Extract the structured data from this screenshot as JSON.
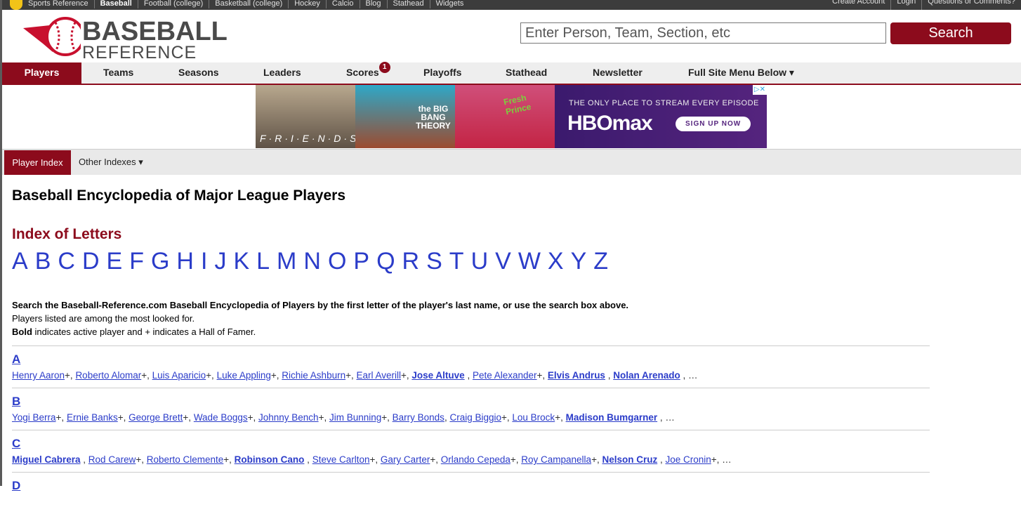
{
  "topbar": {
    "links": [
      "Sports Reference",
      "Baseball",
      "Football (college)",
      "Basketball (college)",
      "Hockey",
      "Calcio",
      "Blog",
      "Stathead",
      "Widgets"
    ],
    "right_links": [
      "Create Account",
      "Login",
      "Questions or Comments?"
    ]
  },
  "logo": {
    "line1": "BASEBALL",
    "line2": "REFERENCE"
  },
  "search": {
    "placeholder": "Enter Person, Team, Section, etc",
    "button": "Search"
  },
  "nav": {
    "items": [
      "Players",
      "Teams",
      "Seasons",
      "Leaders",
      "Scores",
      "Playoffs",
      "Stathead",
      "Newsletter",
      "Full Site Menu Below ▾"
    ],
    "scores_badge": "1"
  },
  "ad": {
    "friends": "F·R·I·E·N·D·S",
    "bbt": "the BIG BANG THEORY",
    "fresh_prince": "Fresh Prince",
    "stream": "THE ONLY PLACE TO STREAM EVERY EPISODE",
    "brand": "HBOmax",
    "cta": "SIGN UP NOW"
  },
  "subnav": {
    "player_index": "Player Index",
    "other_indexes": "Other Indexes ▾"
  },
  "page": {
    "title": "Baseball Encyclopedia of Major League Players",
    "index_heading": "Index of Letters",
    "letters": [
      "A",
      "B",
      "C",
      "D",
      "E",
      "F",
      "G",
      "H",
      "I",
      "J",
      "K",
      "L",
      "M",
      "N",
      "O",
      "P",
      "Q",
      "R",
      "S",
      "T",
      "U",
      "V",
      "W",
      "X",
      "Y",
      "Z"
    ],
    "desc_line1": "Search the Baseball-Reference.com Baseball Encyclopedia of Players by the first letter of the player's last name, or use the search box above.",
    "desc_line2": "Players listed are among the most looked for.",
    "desc_bold": "Bold",
    "desc_line3": " indicates active player and + indicates a Hall of Famer."
  },
  "sections": [
    {
      "letter": "A",
      "players": [
        {
          "name": "Henry Aaron",
          "hof": true,
          "active": false
        },
        {
          "name": "Roberto Alomar",
          "hof": true,
          "active": false
        },
        {
          "name": "Luis Aparicio",
          "hof": true,
          "active": false
        },
        {
          "name": "Luke Appling",
          "hof": true,
          "active": false
        },
        {
          "name": "Richie Ashburn",
          "hof": true,
          "active": false
        },
        {
          "name": "Earl Averill",
          "hof": true,
          "active": false
        },
        {
          "name": "Jose Altuve",
          "hof": false,
          "active": true
        },
        {
          "name": "Pete Alexander",
          "hof": true,
          "active": false
        },
        {
          "name": "Elvis Andrus",
          "hof": false,
          "active": true
        },
        {
          "name": "Nolan Arenado",
          "hof": false,
          "active": true
        }
      ]
    },
    {
      "letter": "B",
      "players": [
        {
          "name": "Yogi Berra",
          "hof": true,
          "active": false
        },
        {
          "name": "Ernie Banks",
          "hof": true,
          "active": false
        },
        {
          "name": "George Brett",
          "hof": true,
          "active": false
        },
        {
          "name": "Wade Boggs",
          "hof": true,
          "active": false
        },
        {
          "name": "Johnny Bench",
          "hof": true,
          "active": false
        },
        {
          "name": "Jim Bunning",
          "hof": true,
          "active": false
        },
        {
          "name": "Barry Bonds",
          "hof": false,
          "active": false
        },
        {
          "name": "Craig Biggio",
          "hof": true,
          "active": false
        },
        {
          "name": "Lou Brock",
          "hof": true,
          "active": false
        },
        {
          "name": "Madison Bumgarner",
          "hof": false,
          "active": true
        }
      ]
    },
    {
      "letter": "C",
      "players": [
        {
          "name": "Miguel Cabrera",
          "hof": false,
          "active": true
        },
        {
          "name": "Rod Carew",
          "hof": true,
          "active": false
        },
        {
          "name": "Roberto Clemente",
          "hof": true,
          "active": false
        },
        {
          "name": "Robinson Cano",
          "hof": false,
          "active": true
        },
        {
          "name": "Steve Carlton",
          "hof": true,
          "active": false
        },
        {
          "name": "Gary Carter",
          "hof": true,
          "active": false
        },
        {
          "name": "Orlando Cepeda",
          "hof": true,
          "active": false
        },
        {
          "name": "Roy Campanella",
          "hof": true,
          "active": false
        },
        {
          "name": "Nelson Cruz",
          "hof": false,
          "active": true
        },
        {
          "name": "Joe Cronin",
          "hof": true,
          "active": false
        }
      ]
    },
    {
      "letter": "D",
      "players": []
    }
  ]
}
